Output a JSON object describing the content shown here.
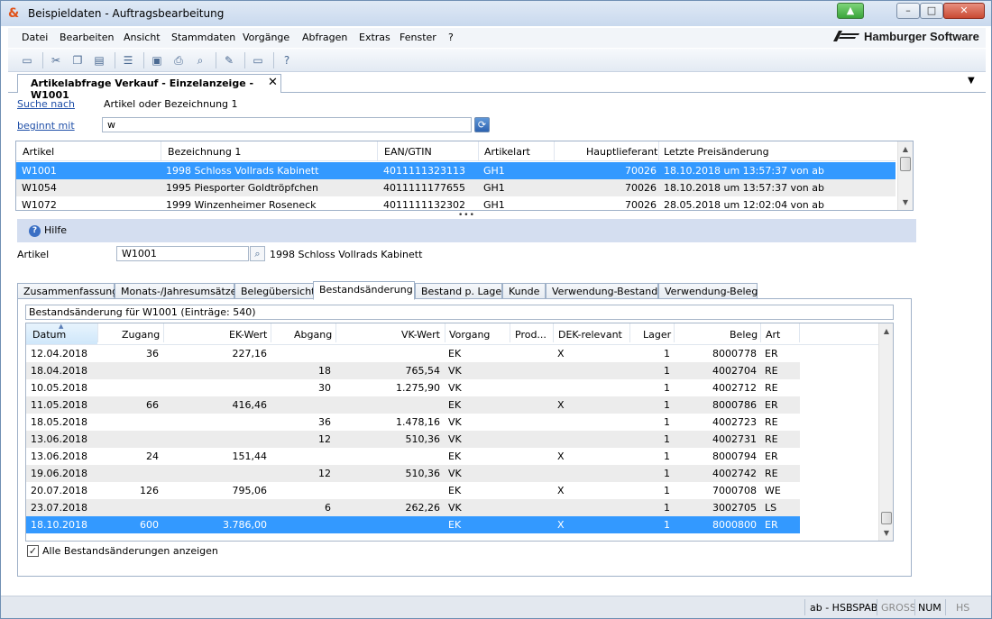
{
  "window": {
    "title": "Beispieldaten - Auftragsbearbeitung",
    "brand": "Hamburger Software"
  },
  "menu": [
    "Datei",
    "Bearbeiten",
    "Ansicht",
    "Stammdaten",
    "Vorgänge",
    "Abfragen",
    "Extras",
    "Fenster",
    "?"
  ],
  "toolbar_icons": [
    "open-folder-icon",
    "cut-icon",
    "copy-icon",
    "paste-icon",
    "list-view-icon",
    "new-document-icon",
    "print-icon",
    "print-preview-icon",
    "properties-icon",
    "window-icon",
    "help-icon"
  ],
  "doc_tab": {
    "label": "Artikelabfrage Verkauf - Einzelanzeige - W1001",
    "close": "✕"
  },
  "search": {
    "field_link": "Suche nach",
    "field_value": "Artikel oder Bezeichnung 1",
    "mode_link": "beginnt mit",
    "query": "w"
  },
  "article_list": {
    "columns": [
      "Artikel",
      "Bezeichnung 1",
      "EAN/GTIN",
      "Artikelart",
      "Hauptlieferant",
      "Letzte Preisänderung"
    ],
    "rows": [
      {
        "artikel": "W1001",
        "bezeichnung": "1998 Schloss Vollrads Kabinett",
        "ean": "4011111323113",
        "art": "GH1",
        "lieferant": "70026",
        "preis": "18.10.2018 um 13:57:37 von ab",
        "selected": true
      },
      {
        "artikel": "W1054",
        "bezeichnung": "1995 Piesporter Goldtröpfchen",
        "ean": "4011111177655",
        "art": "GH1",
        "lieferant": "70026",
        "preis": "18.10.2018 um 13:57:37 von ab",
        "selected": false
      },
      {
        "artikel": "W1072",
        "bezeichnung": "1999 Winzenheimer Roseneck",
        "ean": "4011111132302",
        "art": "GH1",
        "lieferant": "70026",
        "preis": "28.05.2018 um 12:02:04 von ab",
        "selected": false
      }
    ]
  },
  "help": {
    "label": "Hilfe"
  },
  "detail": {
    "artikel_label": "Artikel",
    "artikel_value": "W1001",
    "artikel_name": "1998 Schloss Vollrads Kabinett"
  },
  "tabs": [
    "Zusammenfassung",
    "Monats-/Jahresumsätze",
    "Belegübersicht",
    "Bestandsänderung",
    "Bestand p. Lager",
    "Kunde",
    "Verwendung-Bestand",
    "Verwendung-Beleg"
  ],
  "active_tab": "Bestandsänderung",
  "stock": {
    "caption": "Bestandsänderung für W1001 (Einträge: 540)",
    "columns": [
      "Datum",
      "Zugang",
      "EK-Wert",
      "Abgang",
      "VK-Wert",
      "Vorgang",
      "Prod...",
      "DEK-relevant",
      "Lager",
      "Beleg",
      "Art"
    ],
    "rows": [
      {
        "datum": "12.04.2018",
        "zugang": "36",
        "ekwert": "227,16",
        "abgang": "",
        "vkwert": "",
        "vorgang": "EK",
        "prod": "",
        "dek": "X",
        "lager": "1",
        "beleg": "8000778",
        "art": "ER"
      },
      {
        "datum": "18.04.2018",
        "zugang": "",
        "ekwert": "",
        "abgang": "18",
        "vkwert": "765,54",
        "vorgang": "VK",
        "prod": "",
        "dek": "",
        "lager": "1",
        "beleg": "4002704",
        "art": "RE"
      },
      {
        "datum": "10.05.2018",
        "zugang": "",
        "ekwert": "",
        "abgang": "30",
        "vkwert": "1.275,90",
        "vorgang": "VK",
        "prod": "",
        "dek": "",
        "lager": "1",
        "beleg": "4002712",
        "art": "RE"
      },
      {
        "datum": "11.05.2018",
        "zugang": "66",
        "ekwert": "416,46",
        "abgang": "",
        "vkwert": "",
        "vorgang": "EK",
        "prod": "",
        "dek": "X",
        "lager": "1",
        "beleg": "8000786",
        "art": "ER"
      },
      {
        "datum": "18.05.2018",
        "zugang": "",
        "ekwert": "",
        "abgang": "36",
        "vkwert": "1.478,16",
        "vorgang": "VK",
        "prod": "",
        "dek": "",
        "lager": "1",
        "beleg": "4002723",
        "art": "RE"
      },
      {
        "datum": "13.06.2018",
        "zugang": "",
        "ekwert": "",
        "abgang": "12",
        "vkwert": "510,36",
        "vorgang": "VK",
        "prod": "",
        "dek": "",
        "lager": "1",
        "beleg": "4002731",
        "art": "RE"
      },
      {
        "datum": "13.06.2018",
        "zugang": "24",
        "ekwert": "151,44",
        "abgang": "",
        "vkwert": "",
        "vorgang": "EK",
        "prod": "",
        "dek": "X",
        "lager": "1",
        "beleg": "8000794",
        "art": "ER"
      },
      {
        "datum": "19.06.2018",
        "zugang": "",
        "ekwert": "",
        "abgang": "12",
        "vkwert": "510,36",
        "vorgang": "VK",
        "prod": "",
        "dek": "",
        "lager": "1",
        "beleg": "4002742",
        "art": "RE"
      },
      {
        "datum": "20.07.2018",
        "zugang": "126",
        "ekwert": "795,06",
        "abgang": "",
        "vkwert": "",
        "vorgang": "EK",
        "prod": "",
        "dek": "X",
        "lager": "1",
        "beleg": "7000708",
        "art": "WE"
      },
      {
        "datum": "23.07.2018",
        "zugang": "",
        "ekwert": "",
        "abgang": "6",
        "vkwert": "262,26",
        "vorgang": "VK",
        "prod": "",
        "dek": "",
        "lager": "1",
        "beleg": "3002705",
        "art": "LS"
      },
      {
        "datum": "18.10.2018",
        "zugang": "600",
        "ekwert": "3.786,00",
        "abgang": "",
        "vkwert": "",
        "vorgang": "EK",
        "prod": "",
        "dek": "X",
        "lager": "1",
        "beleg": "8000800",
        "art": "ER",
        "selected": true
      }
    ],
    "checkbox_label": "Alle Bestandsänderungen anzeigen",
    "checkbox_checked": true
  },
  "status": {
    "user": "ab - HSBSPAB",
    "caps": "GROSS",
    "num": "NUM",
    "hs": "HS"
  },
  "colors": {
    "selection": "#3399ff",
    "help_bar": "#d4def0",
    "link": "#1f4fa8"
  }
}
